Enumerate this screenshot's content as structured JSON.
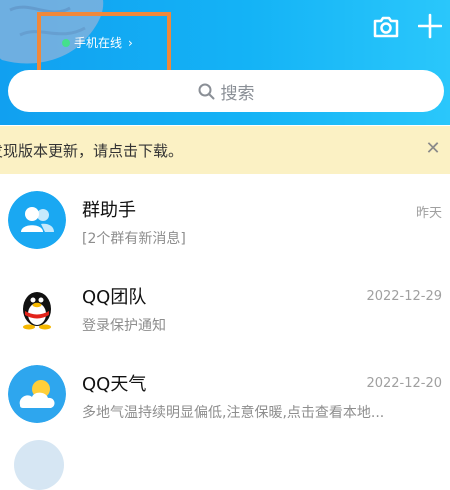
{
  "header": {
    "status_text": "手机在线",
    "status_chevron": "›",
    "camera_icon": "camera-icon",
    "plus_icon": "plus-icon",
    "colors": {
      "bar_start": "#11a0f0",
      "bar_end": "#2ac7fb",
      "highlight": "#f0883a",
      "online": "#44e08c"
    }
  },
  "search": {
    "placeholder": "搜索"
  },
  "banner": {
    "text": "发现版本更新，请点击下载。",
    "close_glyph": "✕"
  },
  "chats": [
    {
      "title": "群助手",
      "subtitle": "[2个群有新消息]",
      "time": "昨天",
      "avatar": "group-assistant-icon"
    },
    {
      "title": "QQ团队",
      "subtitle": "登录保护通知",
      "time": "2022-12-29",
      "avatar": "qq-penguin-icon"
    },
    {
      "title": "QQ天气",
      "subtitle": "多地气温持续明显偏低,注意保暖,点击查看本地...",
      "time": "2022-12-20",
      "avatar": "weather-icon"
    }
  ]
}
